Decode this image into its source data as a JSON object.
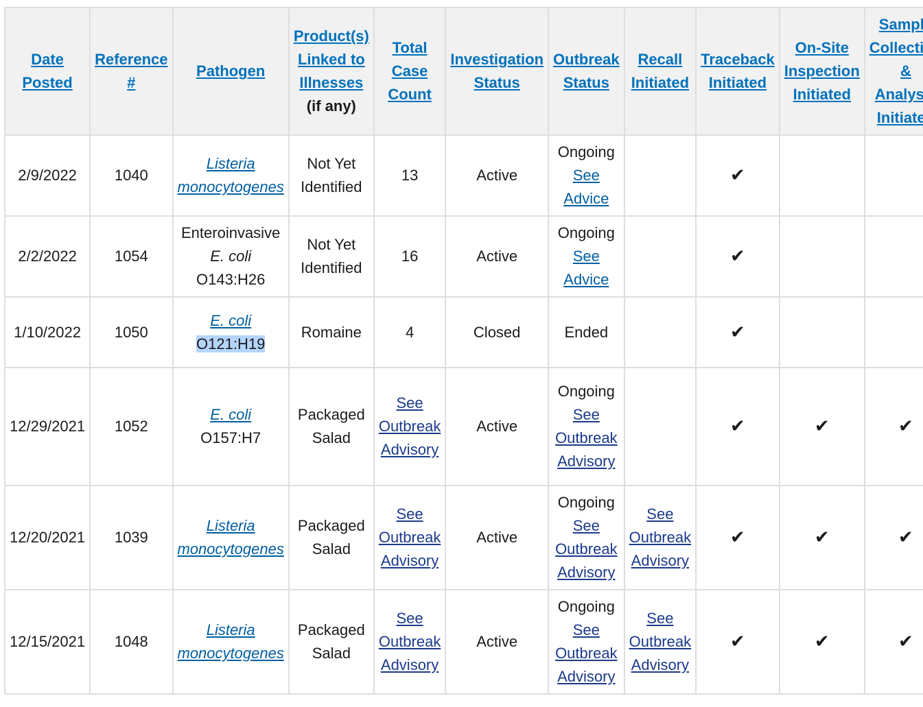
{
  "headers": {
    "date_posted": [
      "Date",
      "Posted"
    ],
    "reference": [
      "Reference",
      "#"
    ],
    "pathogen": [
      "Pathogen"
    ],
    "products": [
      "Product(s)",
      "Linked to",
      "Illnesses"
    ],
    "products_sub": "(if any)",
    "total_case_count": [
      "Total",
      "Case",
      "Count"
    ],
    "investigation_status": [
      "Investigation",
      "Status"
    ],
    "outbreak_status": [
      "Outbreak",
      "Status"
    ],
    "recall_initiated": [
      "Recall",
      "Initiated"
    ],
    "traceback_initiated": [
      "Traceback",
      "Initiated"
    ],
    "onsite_inspection": [
      "On-Site",
      "Inspection",
      "Initiated"
    ],
    "sample_collection": [
      "Sample",
      "Collection",
      "&",
      "Analysis",
      "Initiated"
    ]
  },
  "check_mark": "✔",
  "rows": [
    {
      "date": "2/9/2022",
      "reference": "1040",
      "pathogen": [
        "Listeria",
        "monocytogenes"
      ],
      "product": [
        "Not Yet",
        "Identified"
      ],
      "case_count": "13",
      "investigation": "Active",
      "outbreak_status": "Ongoing",
      "outbreak_link": [
        "See",
        "Advice"
      ]
    },
    {
      "date": "2/2/2022",
      "reference": "1054",
      "pathogen": [
        "Enteroinvasive",
        "E. coli",
        "O143:H26"
      ],
      "product": [
        "Not Yet",
        "Identified"
      ],
      "case_count": "16",
      "investigation": "Active",
      "outbreak_status": "Ongoing",
      "outbreak_link": [
        "See",
        "Advice"
      ]
    },
    {
      "date": "1/10/2022",
      "reference": "1050",
      "pathogen": [
        "E. coli",
        "O121:H19"
      ],
      "product": [
        "Romaine"
      ],
      "case_count": "4",
      "investigation": "Closed",
      "outbreak_status": "Ended"
    },
    {
      "date": "12/29/2021",
      "reference": "1052",
      "pathogen": [
        "E. coli",
        "O157:H7"
      ],
      "product": [
        "Packaged",
        "Salad"
      ],
      "case_link": [
        "See",
        "Outbreak",
        "Advisory"
      ],
      "investigation": "Active",
      "outbreak_status": "Ongoing",
      "outbreak_link": [
        "See",
        "Outbreak",
        "Advisory"
      ]
    },
    {
      "date": "12/20/2021",
      "reference": "1039",
      "pathogen": [
        "Listeria",
        "monocytogenes"
      ],
      "product": [
        "Packaged",
        "Salad"
      ],
      "case_link": [
        "See",
        "Outbreak",
        "Advisory"
      ],
      "investigation": "Active",
      "outbreak_status": "Ongoing",
      "outbreak_link": [
        "See",
        "Outbreak",
        "Advisory"
      ],
      "recall_link": [
        "See",
        "Outbreak",
        "Advisory"
      ]
    },
    {
      "date": "12/15/2021",
      "reference": "1048",
      "pathogen": [
        "Listeria",
        "monocytogenes"
      ],
      "product": [
        "Packaged",
        "Salad"
      ],
      "case_link": [
        "See",
        "Outbreak",
        "Advisory"
      ],
      "investigation": "Active",
      "outbreak_status": "Ongoing",
      "outbreak_link": [
        "See",
        "Outbreak",
        "Advisory"
      ],
      "recall_link": [
        "See",
        "Outbreak",
        "Advisory"
      ]
    }
  ]
}
